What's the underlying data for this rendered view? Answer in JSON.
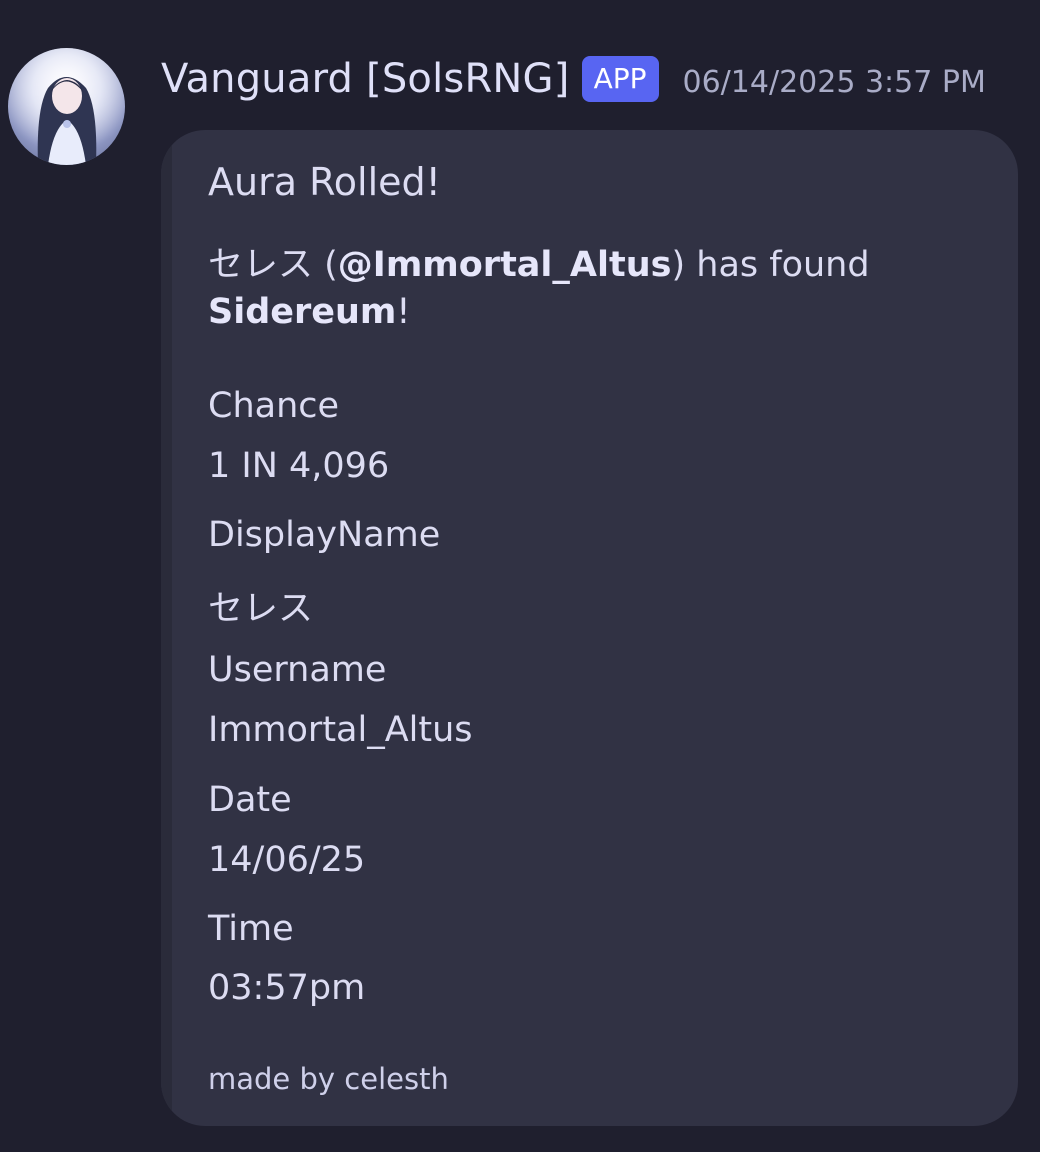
{
  "message": {
    "author": "Vanguard [SolsRNG]",
    "badge": "APP",
    "timestamp": "06/14/2025 3:57 PM"
  },
  "embed": {
    "title": "Aura Rolled!",
    "description": {
      "display_name": "セレス",
      "open_paren": " (",
      "mention": "@Immortal_Altus",
      "middle": ") has found ",
      "aura": "Sidereum",
      "end": "!"
    },
    "fields": [
      {
        "name": "Chance",
        "value": "1 IN 4,096"
      },
      {
        "name": "DisplayName",
        "value": "セレス"
      },
      {
        "name": "Username",
        "value": "Immortal_Altus"
      },
      {
        "name": "Date",
        "value": "14/06/25"
      },
      {
        "name": "Time",
        "value": "03:57pm"
      }
    ],
    "footer": "made by celesth"
  },
  "colors": {
    "background": "#1f1f2e",
    "embed": "#313244",
    "badge": "#5865f2",
    "text": "#dcdcf2",
    "timestamp": "#a9acc7"
  },
  "icons": {
    "avatar": "anime-character-avatar"
  }
}
